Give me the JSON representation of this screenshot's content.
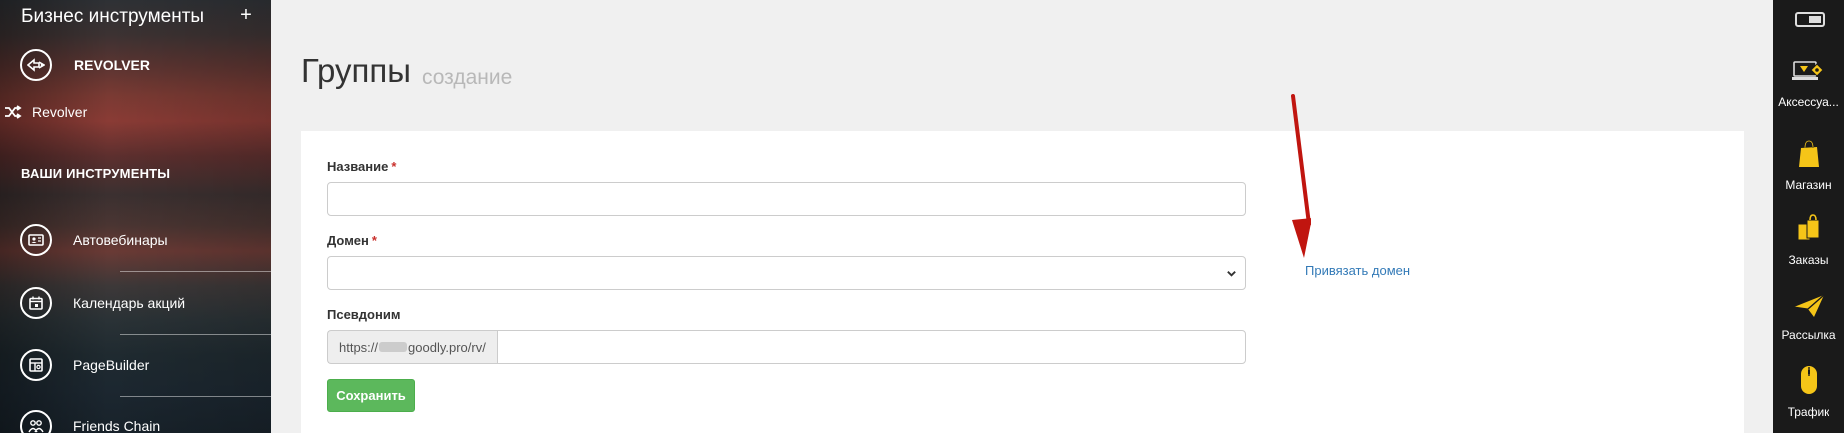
{
  "sidebar": {
    "title": "Бизнес инструменты",
    "plus": "+",
    "revolver_header": "REVOLVER",
    "revolver_item": "Revolver",
    "section_title": "ВАШИ ИНСТРУМЕНТЫ",
    "items": [
      {
        "label": "Автовебинары",
        "icon": "webinar-icon"
      },
      {
        "label": "Календарь акций",
        "icon": "calendar-icon"
      },
      {
        "label": "PageBuilder",
        "icon": "pagebuilder-icon"
      },
      {
        "label": "Friends Chain",
        "icon": "friends-icon"
      }
    ]
  },
  "page": {
    "title": "Группы",
    "subtitle": "создание"
  },
  "form": {
    "name_label": "Название",
    "domain_label": "Домен",
    "required_mark": "*",
    "alias_label": "Псевдоним",
    "alias_prefix_start": "https://",
    "alias_prefix_end": "goodly.pro/rv/",
    "name_value": "",
    "alias_value": "",
    "save_label": "Сохранить",
    "bind_domain_link": "Привязать домен"
  },
  "rightbar": {
    "items": [
      {
        "label": "Аксессуа...",
        "icon": "accessories-icon"
      },
      {
        "label": "Магазин",
        "icon": "shop-bag-icon"
      },
      {
        "label": "Заказы",
        "icon": "orders-icon"
      },
      {
        "label": "Рассылка",
        "icon": "mailing-icon"
      },
      {
        "label": "Трафик",
        "icon": "traffic-mouse-icon"
      }
    ]
  },
  "colors": {
    "save_button": "#5cb85c",
    "link": "#337ab7",
    "required": "#c9302c",
    "annotation_arrow": "#c0150f",
    "rightbar_bg": "#1a1a1a",
    "icon_yellow": "#f5c518"
  }
}
